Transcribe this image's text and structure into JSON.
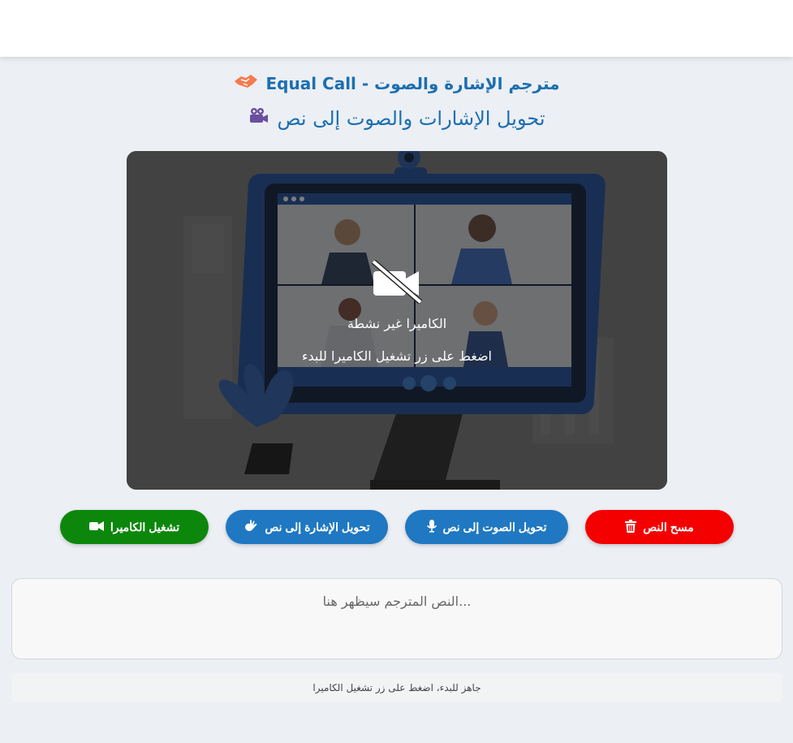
{
  "header": {
    "app_title": "مترجم الإشارة والصوت - Equal Call",
    "title_icon": "handshake-icon",
    "subtitle": "تحويل الإشارات والصوت إلى نص",
    "subtitle_icon": "video-camera-icon"
  },
  "video": {
    "status": "الكاميرا غير نشطة",
    "hint": "اضغط على زر تشغيل الكاميرا للبدء",
    "icon": "video-off-icon"
  },
  "buttons": {
    "clear_label": "مسح النص",
    "voice_label": "تحويل الصوت إلى نص",
    "sign_label": "تحويل الإشارة إلى نص",
    "camera_label": "تشغيل الكاميرا"
  },
  "output": {
    "placeholder": "...النص المترجم سيظهر هنا"
  },
  "status": {
    "text": "جاهز للبدء، اضغط على زر تشغيل الكاميرا"
  },
  "colors": {
    "camera_button": "#0c870c",
    "action_button": "#1f78c1",
    "clear_button": "#f40000",
    "title": "#1b6fb0"
  }
}
